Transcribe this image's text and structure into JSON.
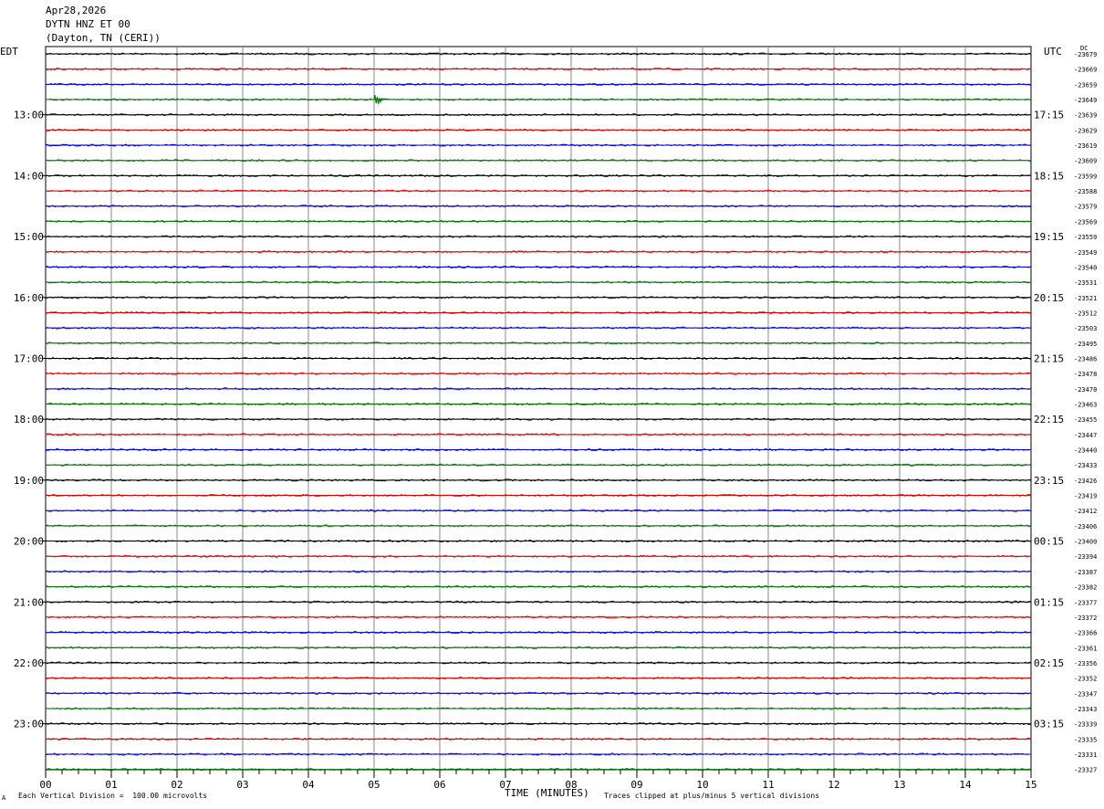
{
  "header": {
    "date": "Apr28,2026",
    "station": "DYTN HNZ ET 00",
    "location": "(Dayton, TN (CERI))"
  },
  "left_tz": "EDT",
  "right_tz": "UTC",
  "dc_label": "DC",
  "footer": {
    "scale_note": "Each Vertical Division =  100.00 microvolts",
    "clip_note": "Traces clipped at plus/minus 5 vertical divisions",
    "marker": "A"
  },
  "chart_data": {
    "type": "line",
    "title": "Apr28,2026 DYTN HNZ ET 00 (Dayton, TN (CERI))",
    "xlabel": "TIME (MINUTES)",
    "xlim": [
      0,
      15
    ],
    "x_ticks": [
      "00",
      "01",
      "02",
      "03",
      "04",
      "05",
      "06",
      "07",
      "08",
      "09",
      "10",
      "11",
      "12",
      "13",
      "14",
      "15"
    ],
    "trace_colors": [
      "#000000",
      "#e00000",
      "#0000e0",
      "#007000"
    ],
    "left_hour_labels": [
      "13:00",
      "14:00",
      "15:00",
      "16:00",
      "17:00",
      "18:00",
      "19:00",
      "20:00",
      "21:00",
      "22:00",
      "23:00"
    ],
    "right_hour_labels": [
      "17:15",
      "18:15",
      "19:15",
      "20:15",
      "21:15",
      "22:15",
      "23:15",
      "00:15",
      "01:15",
      "02:15",
      "03:15"
    ],
    "dc_offsets": [
      "-23679",
      "-23669",
      "-23659",
      "-23649",
      "-23639",
      "-23629",
      "-23619",
      "-23609",
      "-23599",
      "-23588",
      "-23579",
      "-23569",
      "-23559",
      "-23549",
      "-23540",
      "-23531",
      "-23521",
      "-23512",
      "-23503",
      "-23495",
      "-23486",
      "-23478",
      "-23470",
      "-23463",
      "-23455",
      "-23447",
      "-23440",
      "-23433",
      "-23426",
      "-23419",
      "-23412",
      "-23406",
      "-23400",
      "-23394",
      "-23387",
      "-23382",
      "-23377",
      "-23372",
      "-23366",
      "-23361",
      "-23356",
      "-23352",
      "-23347",
      "-23343",
      "-23339",
      "-23335",
      "-23331",
      "-23327"
    ],
    "events": [
      {
        "trace_index": 3,
        "minute": 5.0,
        "note": "small transient"
      }
    ],
    "grid": true
  }
}
